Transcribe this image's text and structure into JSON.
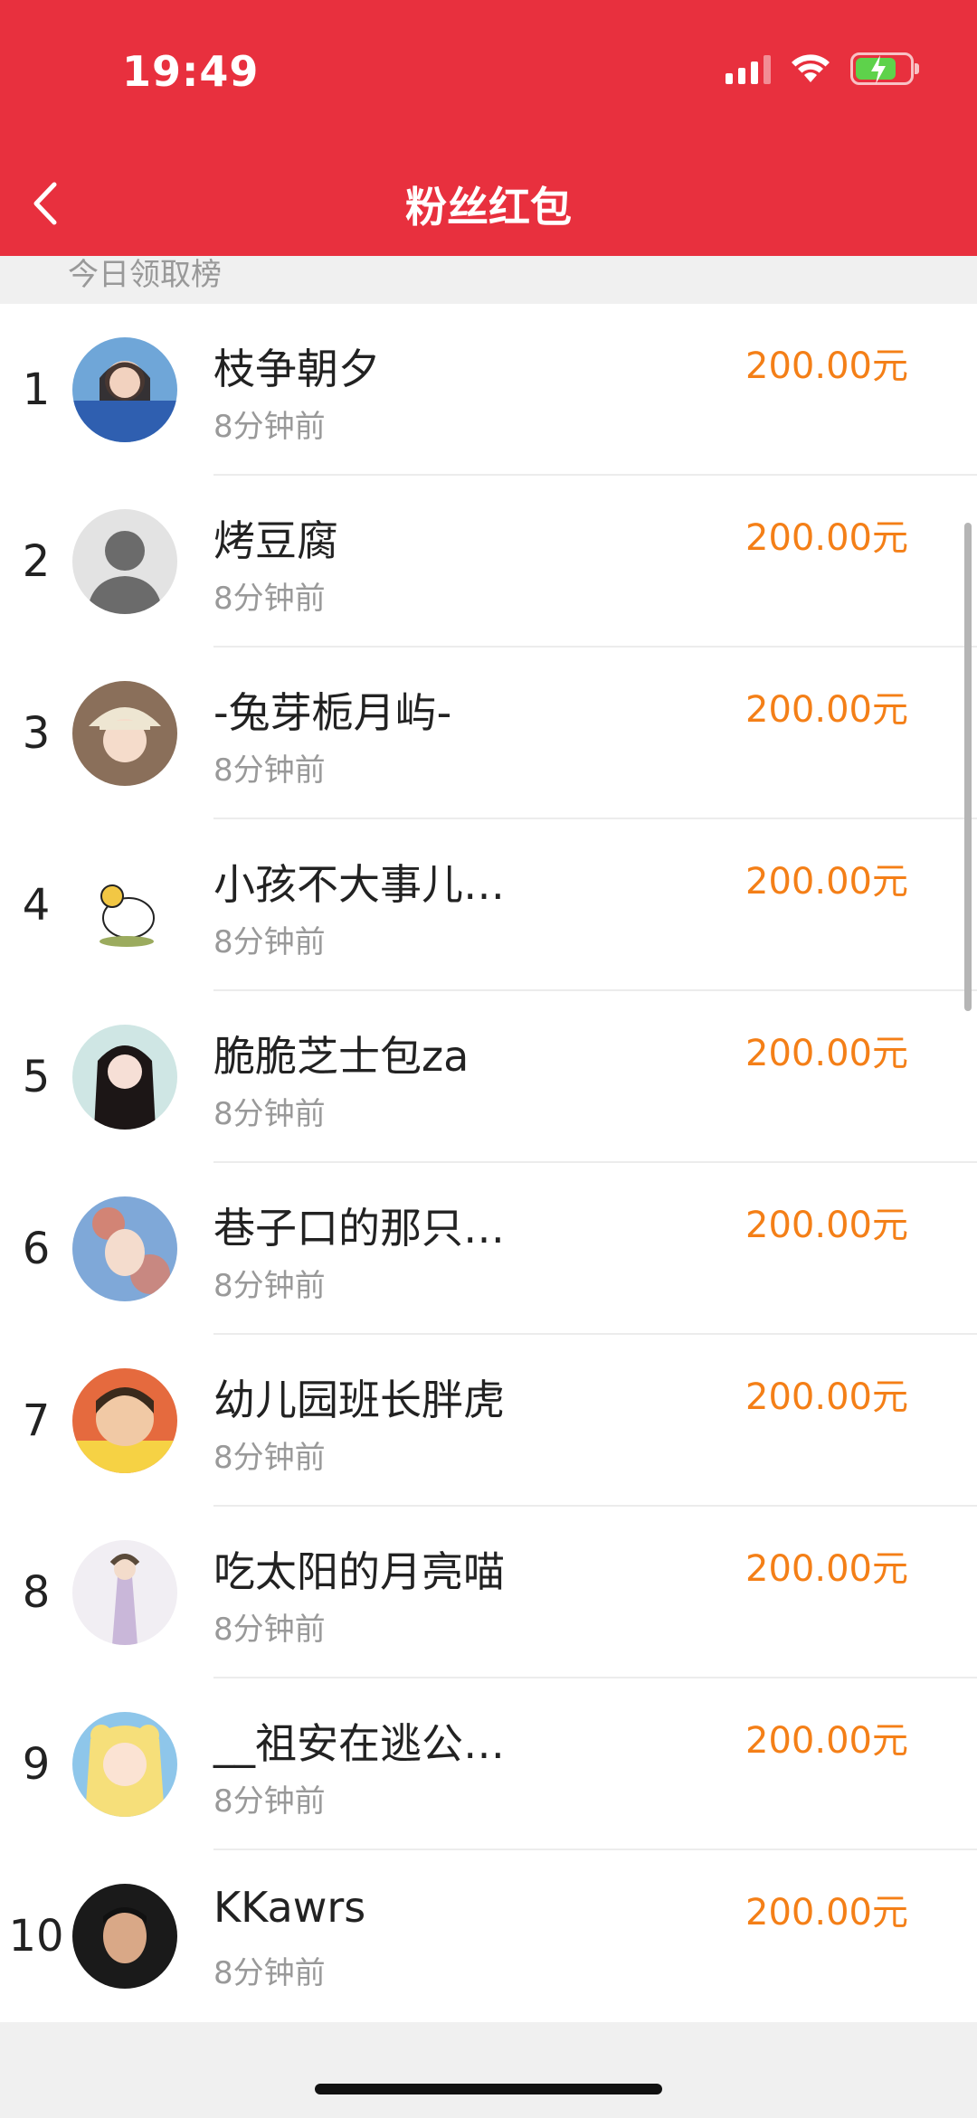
{
  "status": {
    "time": "19:49"
  },
  "header": {
    "title": "粉丝红包"
  },
  "section": {
    "label": "今日领取榜"
  },
  "ranking": [
    {
      "rank": "1",
      "name": "枝争朝夕",
      "time": "8分钟前",
      "amount": "200.00元",
      "avatar": "avatar-girl-blue-jacket"
    },
    {
      "rank": "2",
      "name": "烤豆腐",
      "time": "8分钟前",
      "amount": "200.00元",
      "avatar": "avatar-default-silhouette"
    },
    {
      "rank": "3",
      "name": "-兔芽栀月屿-",
      "time": "8分钟前",
      "amount": "200.00元",
      "avatar": "avatar-girl-hat"
    },
    {
      "rank": "4",
      "name": "小孩不大事儿…",
      "time": "8分钟前",
      "amount": "200.00元",
      "avatar": "avatar-cartoon-sheep"
    },
    {
      "rank": "5",
      "name": "脆脆芝士包za",
      "time": "8分钟前",
      "amount": "200.00元",
      "avatar": "avatar-girl-long-hair"
    },
    {
      "rank": "6",
      "name": "巷子口的那只…",
      "time": "8分钟前",
      "amount": "200.00元",
      "avatar": "avatar-painted-girl"
    },
    {
      "rank": "7",
      "name": "幼儿园班长胖虎",
      "time": "8分钟前",
      "amount": "200.00元",
      "avatar": "avatar-cartoon-gian"
    },
    {
      "rank": "8",
      "name": "吃太阳的月亮喵",
      "time": "8分钟前",
      "amount": "200.00元",
      "avatar": "avatar-illustrated-lady"
    },
    {
      "rank": "9",
      "name": "__祖安在逃公…",
      "time": "8分钟前",
      "amount": "200.00元",
      "avatar": "avatar-anime-sailor"
    },
    {
      "rank": "10",
      "name": "KKawrs",
      "time": "8分钟前",
      "amount": "200.00元",
      "avatar": "avatar-boy-photo"
    }
  ],
  "colors": {
    "brand_red": "#e8303e",
    "amount_orange": "#f47f17",
    "secondary_text": "#999999"
  }
}
